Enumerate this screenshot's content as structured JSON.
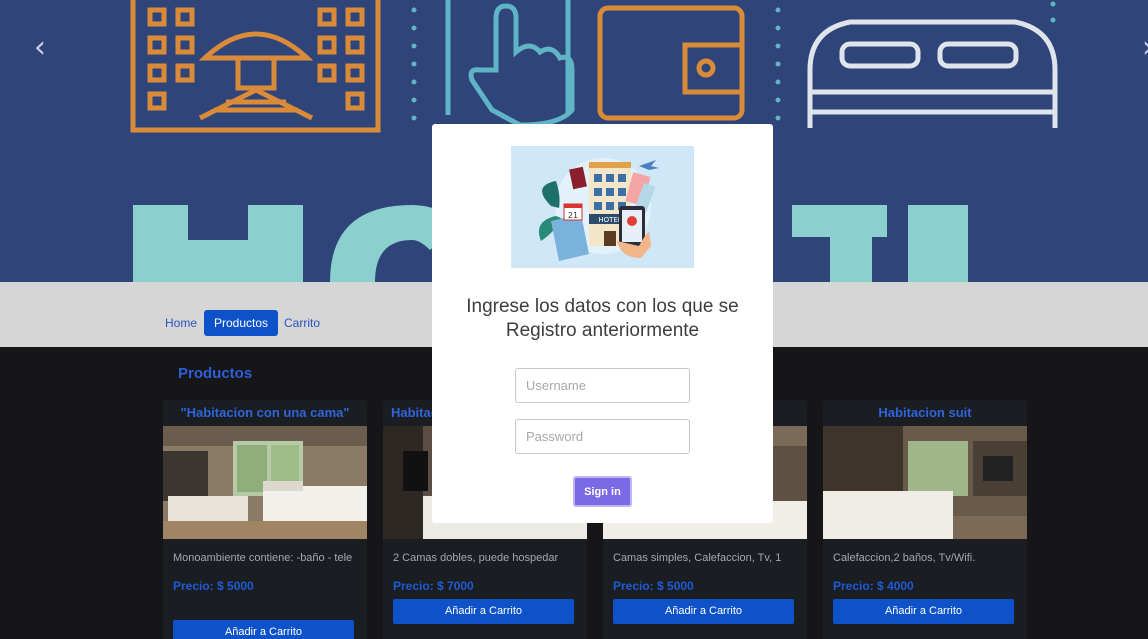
{
  "hero": {
    "prev_icon": "chevron-left-icon",
    "next_icon": "chevron-right-icon",
    "prev_label": "‹",
    "next_label": "›"
  },
  "nav": {
    "items": [
      {
        "label": "Home"
      },
      {
        "label": "Productos",
        "active": true
      },
      {
        "label": "Carrito"
      }
    ]
  },
  "products": {
    "title": "Productos",
    "cards": [
      {
        "title": "\"Habitacion con una cama\"",
        "desc": "Monoambiente contiene: -baño - tele",
        "price": "Precio: $ 5000",
        "button": "Añadir a Carrito"
      },
      {
        "title": "Habitacion",
        "desc": "2 Camas dobles, puede hospedar",
        "price": "Precio: $ 7000",
        "button": "Añadir a Carrito"
      },
      {
        "title": "",
        "desc": "Camas simples, Calefaccion, Tv, 1",
        "price": "Precio: $ 5000",
        "button": "Añadir a Carrito"
      },
      {
        "title": "Habitacion suit",
        "desc": "Calefaccion,2 baños, Tv/Wifi.",
        "price": "Precio: $ 4000",
        "button": "Añadir a Carrito"
      }
    ]
  },
  "modal": {
    "title": "Ingrese los datos con los que se Registro anteriormente",
    "username_placeholder": "Username",
    "password_placeholder": "Password",
    "signin_label": "Sign in",
    "image_text": "HOTEL",
    "calendar_day": "21"
  },
  "colors": {
    "hero_bg": "#2f4479",
    "accent": "#0d52c9",
    "signin": "#7b69e5"
  }
}
